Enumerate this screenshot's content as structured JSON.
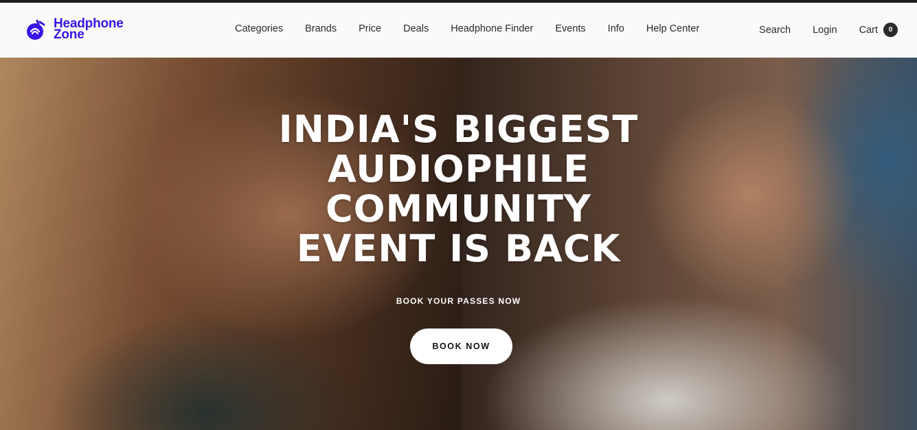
{
  "brand": {
    "line1": "Headphone",
    "line2": "Zone",
    "color": "#3a14e6",
    "icon": "headphone-zone-logo-icon"
  },
  "nav": {
    "items": [
      {
        "label": "Categories"
      },
      {
        "label": "Brands"
      },
      {
        "label": "Price"
      },
      {
        "label": "Deals"
      },
      {
        "label": "Headphone Finder"
      },
      {
        "label": "Events"
      },
      {
        "label": "Info"
      },
      {
        "label": "Help Center"
      }
    ]
  },
  "utility": {
    "search": "Search",
    "login": "Login",
    "cart": "Cart",
    "cart_count": "0"
  },
  "hero": {
    "title_lines": [
      "INDIA'S BIGGEST",
      "AUDIOPHILE",
      "COMMUNITY",
      "EVENT IS BACK"
    ],
    "subtitle": "BOOK YOUR PASSES NOW",
    "cta": "BOOK NOW",
    "image_alt": "Two people wearing headphones at an audiophile event"
  }
}
